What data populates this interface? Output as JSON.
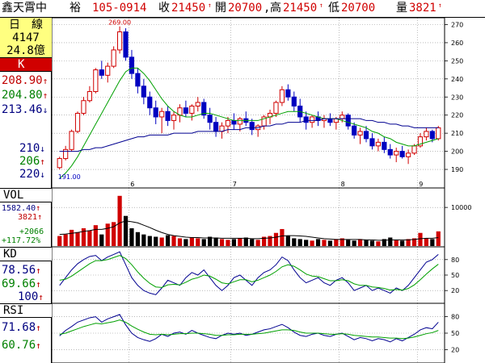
{
  "header": {
    "stock_name": "鑫天霄中",
    "stock_name2": "裕",
    "date": "105-0914",
    "close_label": "收",
    "close": "21450",
    "open_label": "開",
    "open": "20700",
    "high_label": "高",
    "high": "21450",
    "low_label": "低",
    "low": "20700",
    "volume_label": "量",
    "volume": "3821"
  },
  "info": {
    "period_label": "日　線",
    "num1": "4147",
    "num2": "24.8億",
    "k_label": "K",
    "ma1": "208.90",
    "ma2": "204.80",
    "ma3": "213.46",
    "ma4": "210",
    "ma5": "206",
    "ma6": "220",
    "vol_label": "VOL",
    "vol1": "1582.40",
    "vol2": "3821",
    "vol_change1": "+2066",
    "vol_change2": "+117.72%",
    "kd_label": "KD",
    "k_val": "78.56",
    "d_val": "69.66",
    "kd3": "100",
    "rsi_label": "RSI",
    "rsi1": "71.68",
    "rsi2": "60.76"
  },
  "colors": {
    "up": "#d00000",
    "down": "#0000c0",
    "ma_green": "#00a000",
    "ma_blue": "#000090",
    "grid": "#909090"
  },
  "chart_data": [
    {
      "type": "candlestick",
      "name": "price",
      "y_ticks": [
        190,
        200,
        210,
        220,
        230,
        240,
        250,
        260,
        270
      ],
      "ylim": [
        186,
        272
      ],
      "x_ticks": [
        "6",
        "7",
        "8",
        "9"
      ],
      "annotations": {
        "high": "269.00",
        "low": "191.00"
      },
      "candles": [
        [
          191,
          197,
          190,
          196
        ],
        [
          196,
          203,
          195,
          201
        ],
        [
          201,
          212,
          200,
          211
        ],
        [
          211,
          222,
          210,
          221
        ],
        [
          221,
          230,
          220,
          228
        ],
        [
          228,
          236,
          227,
          233
        ],
        [
          233,
          246,
          232,
          245
        ],
        [
          245,
          250,
          240,
          242
        ],
        [
          242,
          249,
          238,
          247
        ],
        [
          247,
          258,
          246,
          256
        ],
        [
          256,
          269,
          254,
          266
        ],
        [
          266,
          268,
          250,
          252
        ],
        [
          252,
          256,
          240,
          243
        ],
        [
          243,
          246,
          232,
          236
        ],
        [
          236,
          240,
          226,
          230
        ],
        [
          230,
          233,
          220,
          224
        ],
        [
          224,
          228,
          215,
          219
        ],
        [
          219,
          224,
          210,
          222
        ],
        [
          222,
          225,
          214,
          217
        ],
        [
          217,
          222,
          212,
          220
        ],
        [
          220,
          226,
          216,
          224
        ],
        [
          224,
          228,
          219,
          221
        ],
        [
          221,
          226,
          217,
          225
        ],
        [
          225,
          230,
          222,
          227
        ],
        [
          227,
          229,
          218,
          220
        ],
        [
          220,
          224,
          212,
          216
        ],
        [
          216,
          219,
          208,
          211
        ],
        [
          211,
          216,
          207,
          214
        ],
        [
          214,
          219,
          210,
          217
        ],
        [
          217,
          221,
          212,
          215
        ],
        [
          215,
          219,
          211,
          218
        ],
        [
          218,
          222,
          214,
          216
        ],
        [
          216,
          218,
          209,
          212
        ],
        [
          212,
          215,
          208,
          214
        ],
        [
          214,
          220,
          212,
          219
        ],
        [
          219,
          223,
          215,
          221
        ],
        [
          221,
          228,
          219,
          227
        ],
        [
          227,
          236,
          225,
          234
        ],
        [
          234,
          237,
          228,
          230
        ],
        [
          230,
          233,
          222,
          225
        ],
        [
          225,
          229,
          216,
          219
        ],
        [
          219,
          222,
          212,
          216
        ],
        [
          216,
          220,
          213,
          219
        ],
        [
          219,
          222,
          214,
          217
        ],
        [
          217,
          220,
          213,
          218
        ],
        [
          218,
          221,
          214,
          216
        ],
        [
          216,
          219,
          212,
          218
        ],
        [
          218,
          222,
          216,
          220
        ],
        [
          220,
          221,
          212,
          214
        ],
        [
          214,
          216,
          207,
          209
        ],
        [
          209,
          213,
          204,
          211
        ],
        [
          211,
          214,
          205,
          207
        ],
        [
          207,
          210,
          201,
          203
        ],
        [
          203,
          207,
          200,
          205
        ],
        [
          205,
          208,
          199,
          201
        ],
        [
          201,
          204,
          196,
          198
        ],
        [
          198,
          202,
          194,
          200
        ],
        [
          200,
          203,
          196,
          197
        ],
        [
          197,
          201,
          193,
          199
        ],
        [
          199,
          204,
          198,
          203
        ],
        [
          203,
          210,
          202,
          208
        ],
        [
          208,
          213,
          206,
          211
        ],
        [
          211,
          212,
          205,
          207
        ],
        [
          207,
          214,
          206,
          213
        ]
      ],
      "ma_green": [
        185,
        188,
        192,
        197,
        203,
        209,
        215,
        221,
        227,
        233,
        239,
        244,
        246,
        246,
        243,
        239,
        234,
        229,
        225,
        222,
        220,
        219,
        219,
        220,
        221,
        221,
        220,
        219,
        218,
        217,
        217,
        217,
        217,
        217,
        218,
        219,
        220,
        221,
        222,
        222,
        222,
        221,
        220,
        219,
        218,
        218,
        218,
        217,
        216,
        215,
        214,
        213,
        211,
        210,
        208,
        207,
        205,
        204,
        203,
        203,
        204,
        205,
        206,
        207
      ],
      "ma_blue": [
        200,
        200,
        200,
        200,
        201,
        201,
        202,
        202,
        203,
        204,
        205,
        206,
        207,
        208,
        208,
        209,
        209,
        209,
        209,
        210,
        210,
        210,
        210,
        211,
        211,
        211,
        211,
        211,
        212,
        212,
        212,
        213,
        213,
        213,
        214,
        214,
        215,
        215,
        216,
        216,
        216,
        217,
        217,
        217,
        218,
        218,
        218,
        218,
        218,
        218,
        218,
        217,
        217,
        216,
        216,
        215,
        215,
        214,
        214,
        213,
        213,
        213,
        213,
        213
      ]
    },
    {
      "type": "bar",
      "name": "volume",
      "y_ticks": [
        10000
      ],
      "ylim": [
        0,
        14000
      ],
      "values": [
        2600,
        3000,
        4200,
        3600,
        4600,
        4000,
        5400,
        3000,
        5800,
        6200,
        13000,
        7800,
        4600,
        3600,
        3000,
        2600,
        2400,
        2200,
        2800,
        2600,
        2000,
        1800,
        2200,
        2000,
        1800,
        2400,
        2200,
        1800,
        1600,
        1800,
        2000,
        2200,
        1800,
        1600,
        2400,
        2600,
        3400,
        4400,
        2600,
        2000,
        1800,
        1600,
        1400,
        1800,
        1600,
        1400,
        1800,
        2000,
        1600,
        1400,
        1800,
        1600,
        1400,
        1200,
        1800,
        2200,
        1600,
        1400,
        1800,
        2000,
        3400,
        2000,
        1800,
        3800
      ],
      "ma": [
        3000,
        3100,
        3300,
        3500,
        3800,
        4000,
        4300,
        4300,
        4600,
        5000,
        6000,
        6500,
        6300,
        6000,
        5400,
        4800,
        4100,
        3500,
        3000,
        2700,
        2500,
        2300,
        2200,
        2200,
        2100,
        2100,
        2100,
        2000,
        2000,
        2000,
        2000,
        2000,
        1900,
        1900,
        2000,
        2100,
        2300,
        2600,
        2700,
        2700,
        2600,
        2500,
        2300,
        2100,
        1900,
        1800,
        1700,
        1700,
        1700,
        1700,
        1700,
        1600,
        1600,
        1500,
        1500,
        1600,
        1600,
        1600,
        1600,
        1700,
        1900,
        2000,
        2000,
        2200
      ]
    },
    {
      "type": "line",
      "name": "KD",
      "y_ticks": [
        20,
        50,
        80
      ],
      "ylim": [
        0,
        100
      ],
      "k": [
        30,
        45,
        60,
        72,
        80,
        86,
        88,
        78,
        85,
        90,
        95,
        70,
        45,
        30,
        20,
        15,
        12,
        25,
        40,
        35,
        30,
        45,
        55,
        50,
        60,
        45,
        30,
        20,
        30,
        45,
        50,
        40,
        30,
        45,
        55,
        60,
        70,
        85,
        78,
        60,
        45,
        35,
        40,
        45,
        35,
        30,
        40,
        45,
        35,
        20,
        25,
        30,
        20,
        25,
        20,
        15,
        25,
        20,
        30,
        45,
        60,
        75,
        80,
        90
      ],
      "d": [
        40,
        42,
        48,
        56,
        64,
        72,
        78,
        78,
        80,
        84,
        88,
        82,
        70,
        56,
        44,
        34,
        27,
        26,
        31,
        32,
        31,
        36,
        42,
        45,
        50,
        48,
        42,
        35,
        33,
        37,
        41,
        41,
        37,
        40,
        45,
        50,
        57,
        66,
        70,
        67,
        60,
        52,
        48,
        47,
        43,
        39,
        39,
        41,
        39,
        33,
        30,
        30,
        27,
        26,
        24,
        21,
        22,
        21,
        24,
        31,
        41,
        52,
        62,
        71
      ]
    },
    {
      "type": "line",
      "name": "RSI",
      "y_ticks": [
        20,
        50,
        80
      ],
      "ylim": [
        0,
        100
      ],
      "rsi1": [
        45,
        55,
        62,
        70,
        74,
        78,
        80,
        70,
        76,
        80,
        84,
        65,
        50,
        42,
        38,
        35,
        40,
        48,
        44,
        50,
        52,
        48,
        55,
        50,
        46,
        42,
        40,
        46,
        50,
        48,
        50,
        46,
        48,
        52,
        56,
        58,
        62,
        66,
        60,
        52,
        46,
        44,
        48,
        50,
        46,
        44,
        48,
        50,
        44,
        38,
        42,
        40,
        36,
        40,
        38,
        34,
        40,
        36,
        42,
        48,
        56,
        60,
        58,
        70
      ],
      "rsi2": [
        48,
        50,
        54,
        58,
        62,
        65,
        68,
        67,
        69,
        71,
        74,
        70,
        63,
        57,
        52,
        48,
        47,
        48,
        47,
        48,
        49,
        49,
        50,
        50,
        49,
        48,
        46,
        46,
        47,
        47,
        48,
        48,
        48,
        49,
        50,
        52,
        54,
        56,
        56,
        55,
        52,
        50,
        50,
        50,
        49,
        48,
        48,
        49,
        48,
        46,
        45,
        44,
        43,
        43,
        42,
        41,
        41,
        40,
        41,
        43,
        46,
        49,
        51,
        55
      ]
    }
  ]
}
